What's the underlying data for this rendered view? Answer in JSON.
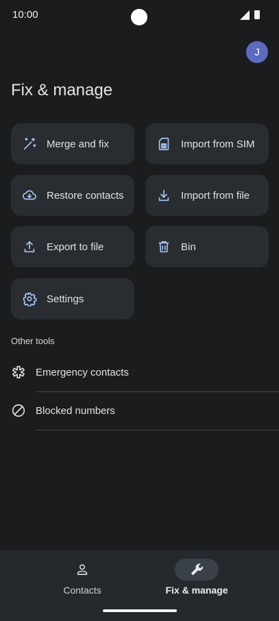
{
  "status_bar": {
    "time": "10:00"
  },
  "header": {
    "avatar_initial": "J",
    "title": "Fix & manage"
  },
  "tiles": [
    {
      "label": "Merge and fix",
      "icon": "magic-wand-icon"
    },
    {
      "label": "Import from SIM",
      "icon": "sim-card-icon"
    },
    {
      "label": "Restore contacts",
      "icon": "cloud-download-icon"
    },
    {
      "label": "Import from file",
      "icon": "download-icon"
    },
    {
      "label": "Export to file",
      "icon": "upload-icon"
    },
    {
      "label": "Bin",
      "icon": "trash-icon"
    },
    {
      "label": "Settings",
      "icon": "gear-icon"
    }
  ],
  "other_tools": {
    "label": "Other tools",
    "items": [
      {
        "label": "Emergency contacts",
        "icon": "asterisk-icon"
      },
      {
        "label": "Blocked numbers",
        "icon": "block-icon"
      }
    ]
  },
  "bottom_nav": {
    "items": [
      {
        "label": "Contacts",
        "icon": "person-icon",
        "active": false
      },
      {
        "label": "Fix & manage",
        "icon": "wrench-icon",
        "active": true
      }
    ]
  },
  "colors": {
    "background": "#1b1c1e",
    "tile": "#292c30",
    "icon_accent": "#a8c7fa",
    "avatar": "#5c6bc0",
    "nav_background": "#25292e"
  }
}
